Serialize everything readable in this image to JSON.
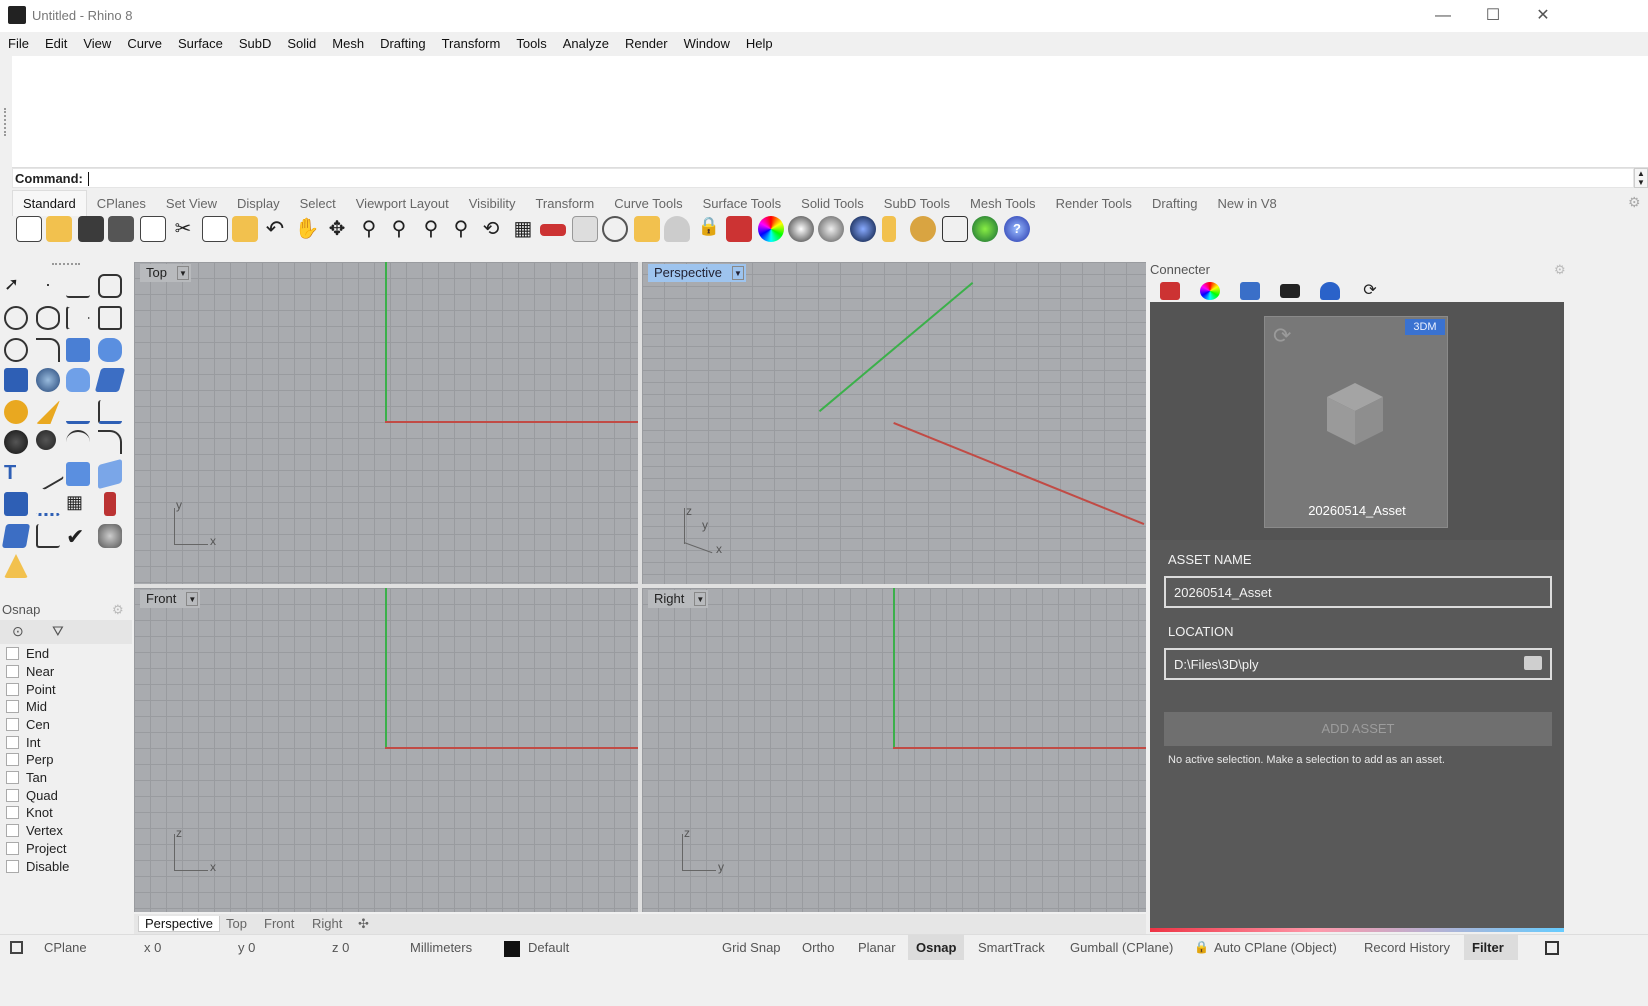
{
  "window": {
    "title": "Untitled - Rhino 8",
    "minimize": "—",
    "maximize": "☐",
    "close": "✕"
  },
  "menu": [
    "File",
    "Edit",
    "View",
    "Curve",
    "Surface",
    "SubD",
    "Solid",
    "Mesh",
    "Drafting",
    "Transform",
    "Tools",
    "Analyze",
    "Render",
    "Window",
    "Help"
  ],
  "command": {
    "label": "Command:",
    "value": ""
  },
  "toolbar_tabs": [
    "Standard",
    "CPlanes",
    "Set View",
    "Display",
    "Select",
    "Viewport Layout",
    "Visibility",
    "Transform",
    "Curve Tools",
    "Surface Tools",
    "Solid Tools",
    "SubD Tools",
    "Mesh Tools",
    "Render Tools",
    "Drafting",
    "New in V8"
  ],
  "viewports": {
    "top": "Top",
    "perspective": "Perspective",
    "front": "Front",
    "right": "Right"
  },
  "axis_glyph_labels": {
    "top": [
      "y",
      "x"
    ],
    "perspective": [
      "z",
      "y",
      "x"
    ],
    "front": [
      "z",
      "x"
    ],
    "right": [
      "z",
      "y"
    ]
  },
  "viewport_tabs": [
    "Perspective",
    "Top",
    "Front",
    "Right",
    "✣"
  ],
  "osnap": {
    "title": "Osnap",
    "items": [
      "End",
      "Near",
      "Point",
      "Mid",
      "Cen",
      "Int",
      "Perp",
      "Tan",
      "Quad",
      "Knot",
      "Vertex",
      "Project",
      "Disable"
    ]
  },
  "connecter": {
    "title": "Connecter",
    "badge": "3DM",
    "asset_card_name": "20260514_Asset",
    "asset_name_label": "ASSET NAME",
    "asset_name_value": "20260514_Asset",
    "location_label": "LOCATION",
    "location_value": "D:\\Files\\3D\\ply",
    "add_asset_label": "ADD ASSET",
    "hint": "No active selection. Make a selection to add as an asset."
  },
  "status": {
    "cplane": "CPlane",
    "x": "x 0",
    "y": "y 0",
    "z": "z 0",
    "units": "Millimeters",
    "layer": "Default",
    "grid_snap": "Grid Snap",
    "ortho": "Ortho",
    "planar": "Planar",
    "osnap": "Osnap",
    "smarttrack": "SmartTrack",
    "gumball": "Gumball (CPlane)",
    "auto_cplane": "Auto CPlane (Object)",
    "record_history": "Record History",
    "filter": "Filter"
  },
  "colors": {
    "x_axis": "#c14b45",
    "y_axis": "#3bb04a",
    "active_viewport_label": "#9ec4ee",
    "panel_bg": "#545454",
    "badge": "#3a72d1"
  }
}
